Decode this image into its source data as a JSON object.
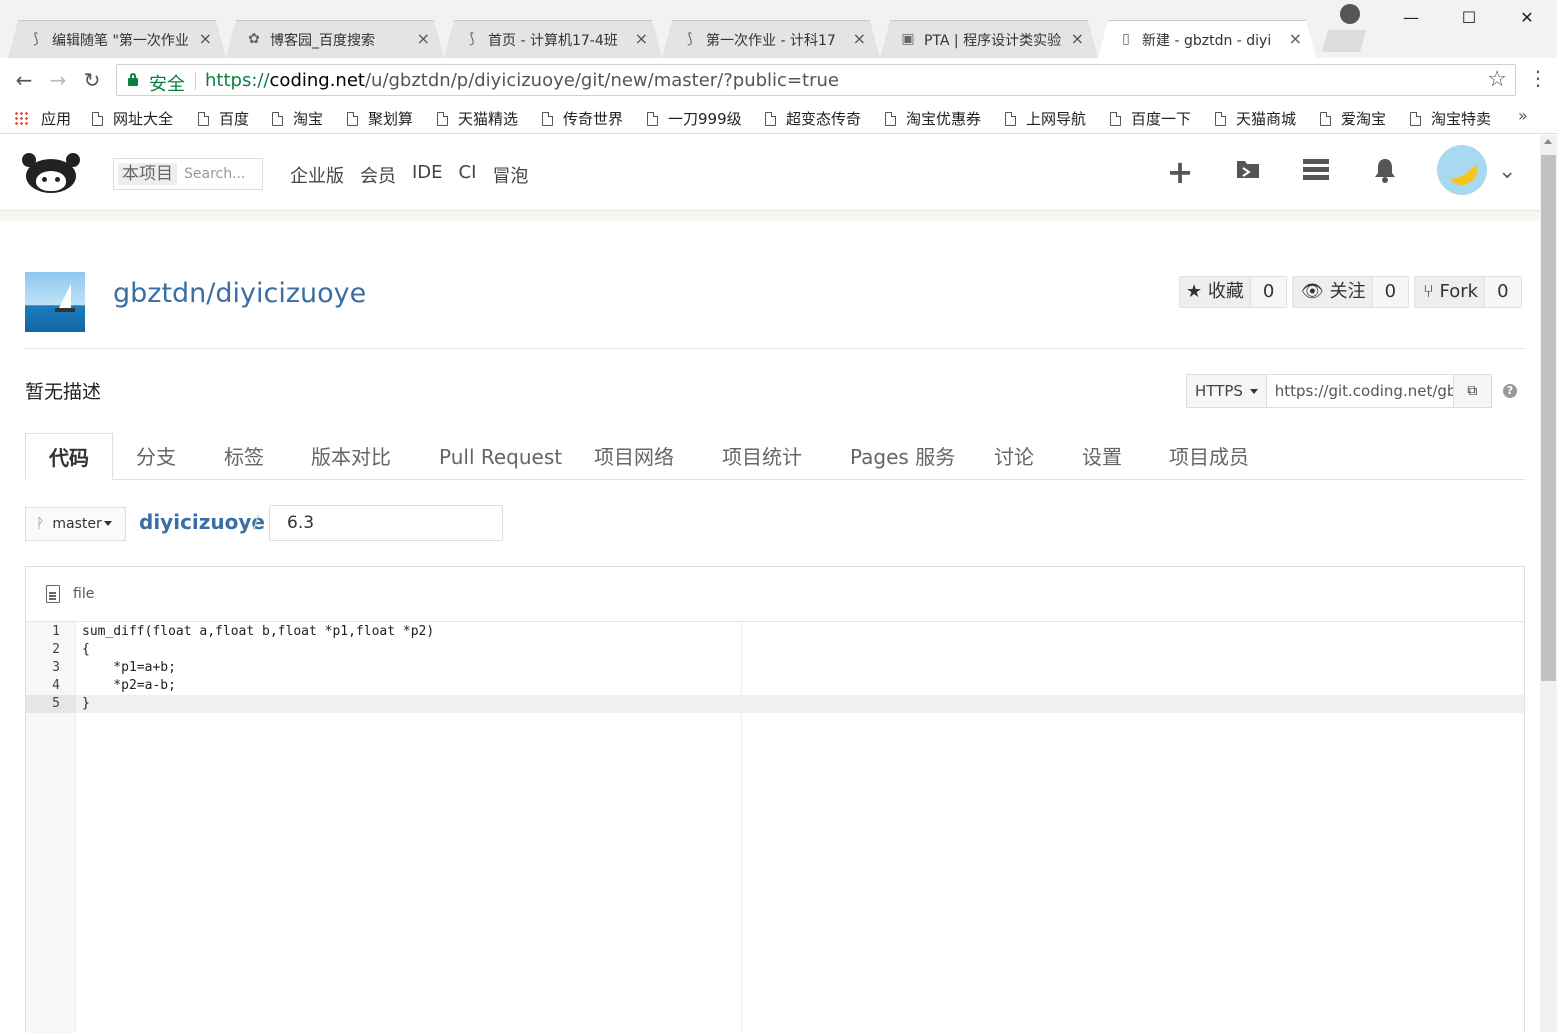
{
  "browser": {
    "tabs": [
      {
        "title": "编辑随笔 \"第一次作业",
        "icon": "cnblogs-icon"
      },
      {
        "title": "博客园_百度搜索",
        "icon": "baidu-icon"
      },
      {
        "title": "首页 - 计算机17-4班",
        "icon": "cnblogs-icon"
      },
      {
        "title": "第一次作业 - 计科17",
        "icon": "cnblogs-icon"
      },
      {
        "title": "PTA | 程序设计类实验",
        "icon": "pta-icon"
      },
      {
        "title": "新建 - gbztdn - diyi",
        "icon": "page-icon"
      }
    ],
    "close_glyph": "×",
    "address": {
      "secure_label": "安全",
      "url_scheme": "https://",
      "url_host": "coding.net",
      "url_path": "/u/gbztdn/p/diyicizuoye/git/new/master/?public=true"
    },
    "bookmarks": [
      "应用",
      "网址大全",
      "百度",
      "淘宝",
      "聚划算",
      "天猫精选",
      "传奇世界",
      "一刀999级",
      "超变态传奇",
      "淘宝优惠券",
      "上网导航",
      "百度一下",
      "天猫商城",
      "爱淘宝",
      "淘宝特卖"
    ],
    "bookmarks_more": "»"
  },
  "header": {
    "search_scope": "本项目",
    "search_placeholder": "Search...",
    "nav": [
      "企业版",
      "会员",
      "IDE",
      "CI",
      "冒泡"
    ]
  },
  "project": {
    "title": "gbztdn/diyicizuoye",
    "description": "暂无描述",
    "star_label": "收藏",
    "star_count": "0",
    "watch_label": "关注",
    "watch_count": "0",
    "fork_label": "Fork",
    "fork_count": "0",
    "clone_protocol": "HTTPS",
    "clone_url": "https://git.coding.net/gbztdn/diyicizuoye.git",
    "help": "?"
  },
  "tabs": [
    "代码",
    "分支",
    "标签",
    "版本对比",
    "Pull Request",
    "项目网络",
    "项目统计",
    "Pages 服务",
    "讨论",
    "设置",
    "项目成员"
  ],
  "path": {
    "branch": "master",
    "repo": "diyicizuoye",
    "separator": "/",
    "filename": "6.3"
  },
  "editor": {
    "mode_label": "file",
    "current_line": 5,
    "lines": [
      "sum_diff(float a,float b,float *p1,float *p2)",
      "{",
      "    *p1=a+b;",
      "    *p2=a-b;",
      "}"
    ]
  }
}
